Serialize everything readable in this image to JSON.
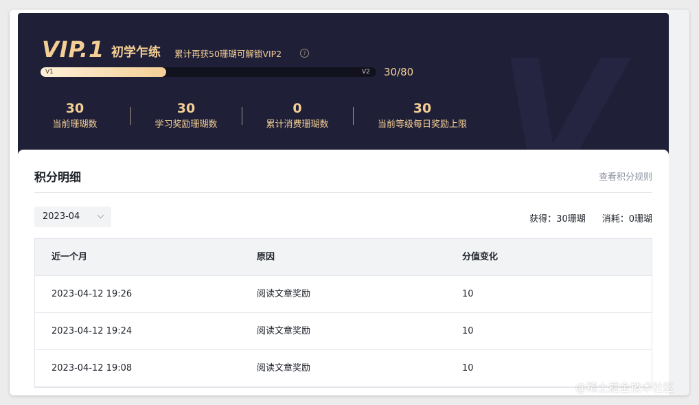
{
  "vip": {
    "level_title": "VIP.1",
    "level_name": "初学乍练",
    "hint": "累计再获50珊瑚可解锁VIP2",
    "help_icon": "question-circle-icon",
    "progress_start_label": "V1",
    "progress_end_label": "V2",
    "progress_text": "30/80",
    "progress_fraction": 0.375,
    "colors": {
      "gold": "#f4cf95",
      "banner_bg": "#1f1f38"
    }
  },
  "stats": [
    {
      "value": "30",
      "label": "当前珊瑚数"
    },
    {
      "value": "30",
      "label": "学习奖励珊瑚数"
    },
    {
      "value": "0",
      "label": "累计消费珊瑚数"
    },
    {
      "value": "30",
      "label": "当前等级每日奖励上限"
    }
  ],
  "details": {
    "title": "积分明细",
    "rules_link": "查看积分规则",
    "month_select": {
      "value": "2023-04",
      "icon": "chevron-down-icon"
    },
    "summary": {
      "earned": "获得：30珊瑚",
      "spent": "消耗：0珊瑚"
    },
    "table": {
      "headers": [
        "近一个月",
        "原因",
        "分值变化"
      ],
      "rows": [
        [
          "2023-04-12 19:26",
          "阅读文章奖励",
          "10"
        ],
        [
          "2023-04-12 19:24",
          "阅读文章奖励",
          "10"
        ],
        [
          "2023-04-12 19:08",
          "阅读文章奖励",
          "10"
        ]
      ]
    }
  },
  "watermark": "@稀土掘金技术社区"
}
